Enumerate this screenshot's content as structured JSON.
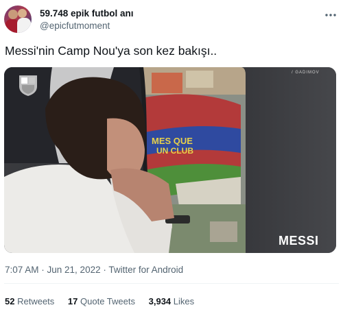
{
  "tweet": {
    "author": {
      "display_name": "59.748 epik futbol anı",
      "handle": "@epicfutmoment",
      "avatar_icon": "player-avatar"
    },
    "more_icon": "more-horizontal-icon",
    "text": "Messi'nin Camp Nou'ya son kez bakışı..",
    "media": {
      "watermark_top": "/ GADIMOV",
      "watermark_brand": "MESSI"
    },
    "meta": "7:07 AM · Jun 21, 2022 · Twitter for Android",
    "stats": {
      "retweets_count": "52",
      "retweets_label": "Retweets",
      "quotes_count": "17",
      "quotes_label": "Quote Tweets",
      "likes_count": "3,934",
      "likes_label": "Likes"
    }
  },
  "colors": {
    "text_primary": "#0f1419",
    "text_secondary": "#536471",
    "divider": "#eff3f4",
    "stadium_red": "#b33a3a",
    "pitch_green": "#4e8f3a"
  }
}
